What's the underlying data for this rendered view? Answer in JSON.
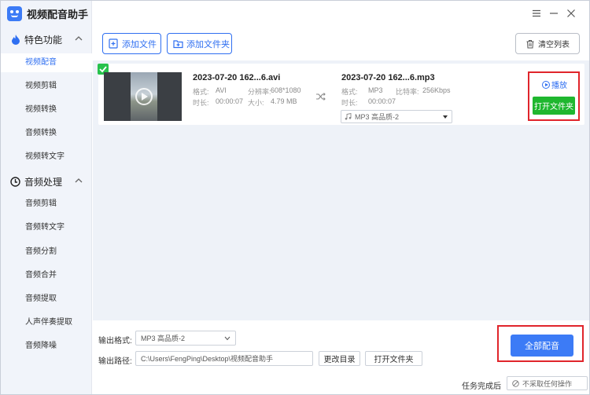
{
  "app": {
    "title": "视频配音助手",
    "brand_color": "#3c7bf6"
  },
  "window": {
    "menu_icon": "menu-icon",
    "minimize_icon": "minimize-icon",
    "close_icon": "close-icon"
  },
  "sidebar": {
    "group1": {
      "label": "特色功能",
      "icon": "flame-icon"
    },
    "items1": [
      "视频配音",
      "视频剪辑",
      "视频转换",
      "音频转换",
      "视频转文字"
    ],
    "group2": {
      "label": "音频处理",
      "icon": "disc-icon"
    },
    "items2": [
      "音频剪辑",
      "音频转文字",
      "音频分割",
      "音频合并",
      "音频提取",
      "人声伴奏提取",
      "音频降噪"
    ]
  },
  "toolbar": {
    "add_file": "添加文件",
    "add_folder": "添加文件夹",
    "clear_list": "清空列表"
  },
  "file": {
    "source_name": "2023-07-20 162...6.avi",
    "target_name": "2023-07-20 162...6.mp3",
    "src_format_label": "格式:",
    "src_format": "AVI",
    "resolution_label": "分辨率:",
    "resolution": "608*1080",
    "src_duration_label": "时长:",
    "src_duration": "00:00:07",
    "size_label": "大小:",
    "size": "4.79 MB",
    "dst_format_label": "格式:",
    "dst_format": "MP3",
    "bitrate_label": "比特率:",
    "bitrate": "256Kbps",
    "dst_duration_label": "时长:",
    "dst_duration": "00:00:07",
    "output_format": "MP3   高品质-2",
    "play": "播放",
    "open_folder": "打开文件夹"
  },
  "bottom": {
    "format_label": "输出格式:",
    "format_value": "MP3   高品质-2",
    "path_label": "输出路径:",
    "path_value": "C:\\Users\\FengPing\\Desktop\\视频配音助手",
    "change_dir": "更改目录",
    "open_folder": "打开文件夹",
    "convert_all": "全部配音",
    "after_done_label": "任务完成后",
    "after_done_value": "不采取任何操作"
  }
}
